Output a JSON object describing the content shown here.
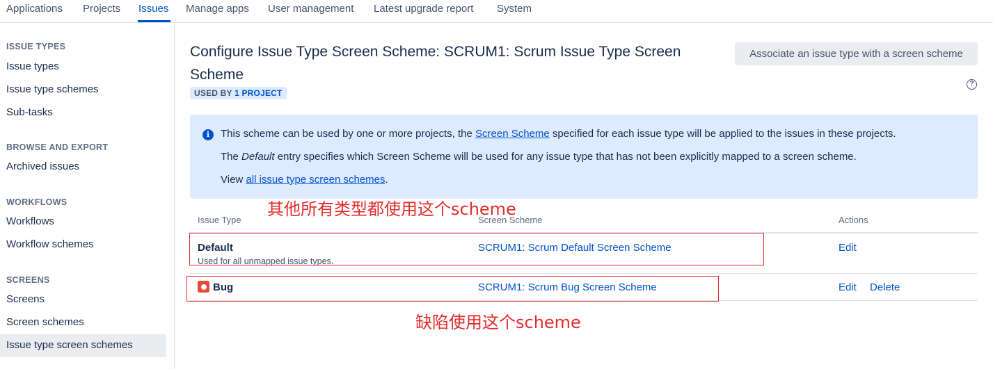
{
  "topnav": {
    "tabs": [
      {
        "label": "Applications",
        "active": false
      },
      {
        "label": "Projects",
        "active": false
      },
      {
        "label": "Issues",
        "active": true
      },
      {
        "label": "Manage apps",
        "active": false
      },
      {
        "label": "User management",
        "active": false
      },
      {
        "label": "Latest upgrade report",
        "active": false
      },
      {
        "label": "System",
        "active": false
      }
    ]
  },
  "sidebar": {
    "sections": [
      {
        "heading": "ISSUE TYPES",
        "items": [
          "Issue types",
          "Issue type schemes",
          "Sub-tasks"
        ]
      },
      {
        "heading": "BROWSE AND EXPORT",
        "items": [
          "Archived issues"
        ]
      },
      {
        "heading": "WORKFLOWS",
        "items": [
          "Workflows",
          "Workflow schemes"
        ]
      },
      {
        "heading": "SCREENS",
        "items": [
          "Screens",
          "Screen schemes",
          "Issue type screen schemes"
        ]
      }
    ],
    "selected_item": "Issue type screen schemes"
  },
  "page": {
    "title": "Configure Issue Type Screen Scheme: SCRUM1: Scrum Issue Type Screen Scheme",
    "used_by_prefix": "USED BY ",
    "used_by_count": "1 PROJECT",
    "associate_button": "Associate an issue type with a screen scheme",
    "help_icon_glyph": "?"
  },
  "info": {
    "icon_glyph": "i",
    "line1_before": "This scheme can be used by one or more projects, the ",
    "line1_link": "Screen Scheme",
    "line1_after": " specified for each issue type will be applied to the issues in these projects.",
    "line2_before": "The ",
    "line2_em": "Default",
    "line2_after": " entry specifies which Screen Scheme will be used for any issue type that has not been explicitly mapped to a screen scheme.",
    "line3_before": "View ",
    "line3_link": "all issue type screen schemes",
    "line3_after": "."
  },
  "table": {
    "headers": {
      "issue_type": "Issue Type",
      "screen_scheme": "Screen Scheme",
      "actions": "Actions"
    },
    "rows": [
      {
        "issue_type": "Default",
        "description": "Used for all unmapped issue types.",
        "screen_scheme": "SCRUM1: Scrum Default Screen Scheme",
        "actions": [
          "Edit"
        ]
      },
      {
        "issue_type": "Bug",
        "icon": "bug-icon",
        "screen_scheme": "SCRUM1: Scrum Bug Screen Scheme",
        "actions": [
          "Edit",
          "Delete"
        ]
      }
    ]
  },
  "annotations": {
    "default_note": "其他所有类型都使用这个scheme",
    "bug_note": "缺陷使用这个scheme",
    "color": "#e32c2c"
  },
  "colors": {
    "link": "#0052cc",
    "info_bg": "#deebff",
    "bug_icon": "#e5493a"
  }
}
